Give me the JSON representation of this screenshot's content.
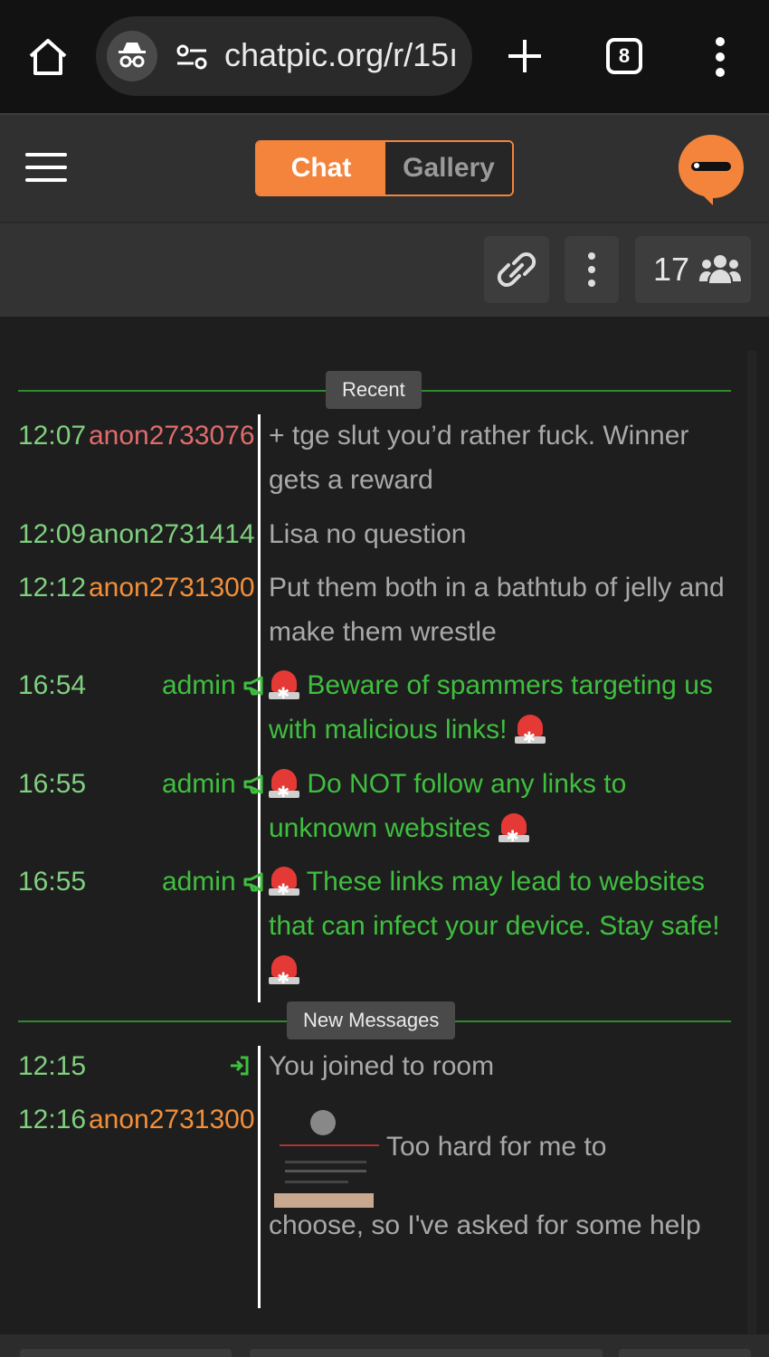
{
  "browser": {
    "url": "chatpic.org/r/15ı",
    "tab_count": "8"
  },
  "header": {
    "tabs": [
      "Chat",
      "Gallery"
    ],
    "active_tab": "Chat"
  },
  "toolbar": {
    "user_count": "17"
  },
  "dividers": {
    "recent": "Recent",
    "new_messages": "New Messages"
  },
  "messages": [
    {
      "time": "12:07",
      "user": "anon2733076",
      "text": "+ tge slut you’d rather fuck. Winner gets a reward"
    },
    {
      "time": "12:09",
      "user": "anon2731414",
      "text": "Lisa no question"
    },
    {
      "time": "12:12",
      "user": "anon2731300",
      "text": "Put them both in a bathtub of jelly and make them wrestle"
    },
    {
      "time": "16:54",
      "user": "admin",
      "text": "Beware of spammers targeting us with malicious links!"
    },
    {
      "time": "16:55",
      "user": "admin",
      "text": "Do NOT follow any links to unknown websites"
    },
    {
      "time": "16:55",
      "user": "admin",
      "text": "These links may lead to websites that can infect your device. Stay safe!"
    }
  ],
  "new_messages": [
    {
      "time": "12:15",
      "user": "",
      "text": "You joined to room"
    },
    {
      "time": "12:16",
      "user": "anon2731300",
      "text_line1": "Too hard for me to",
      "text_rest": "choose, so I've asked for some help"
    }
  ],
  "colors": {
    "accent": "#f4843c",
    "admin_green": "#3fbf3f",
    "time_green": "#7fd07f",
    "divider_green": "#2e8b2e"
  }
}
